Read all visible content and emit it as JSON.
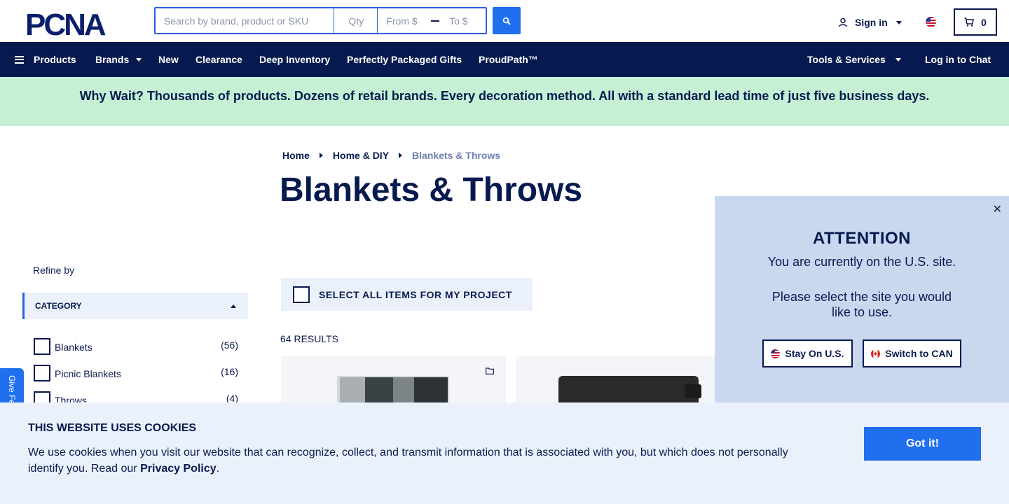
{
  "header": {
    "logo_text": "PCNA",
    "search": {
      "placeholder": "Search by brand, product or SKU",
      "qty_placeholder": "Qty",
      "from_placeholder": "From $",
      "to_placeholder": "To $"
    },
    "sign_in": "Sign in",
    "cart_count": "0"
  },
  "nav": {
    "products": "Products",
    "brands": "Brands",
    "new": "New",
    "clearance": "Clearance",
    "deep_inventory": "Deep Inventory",
    "gifts": "Perfectly Packaged Gifts",
    "proudpath": "ProudPath™",
    "tools": "Tools & Services",
    "chat": "Log in to Chat"
  },
  "promo": "Why Wait? Thousands of products. Dozens of retail brands. Every decoration method. All with a standard lead time of just five business days.",
  "breadcrumb": [
    "Home",
    "Home & DIY",
    "Blankets & Throws"
  ],
  "page_title": "Blankets & Throws",
  "sidebar": {
    "refine": "Refine by",
    "category_header": "CATEGORY",
    "facets": [
      {
        "label": "Blankets",
        "count": "(56)"
      },
      {
        "label": "Picnic Blankets",
        "count": "(16)"
      },
      {
        "label": "Throws",
        "count": "(4)"
      }
    ],
    "feedback": "Give Feedback"
  },
  "main": {
    "select_all": "SELECT ALL ITEMS FOR MY PROJECT",
    "results": "64 RESULTS"
  },
  "attention": {
    "title": "ATTENTION",
    "message1": "You are currently on the U.S. site.",
    "message2": "Please select the site you would like to use.",
    "stay_us": "Stay On U.S.",
    "switch_can": "Switch to CAN"
  },
  "cookie": {
    "title": "THIS WEBSITE USES COOKIES",
    "text": "We use cookies when you visit our website that can recognize, collect, and transmit information that is associated with you, but which does not personally identify you. Read our",
    "link": "Privacy Policy",
    "period": ".",
    "button": "Got it!"
  },
  "colors": {
    "navy": "#061a4f",
    "accent_blue": "#1f6fef",
    "promo_green": "#c6f0d4",
    "panel_blue": "#c9d8ef"
  }
}
